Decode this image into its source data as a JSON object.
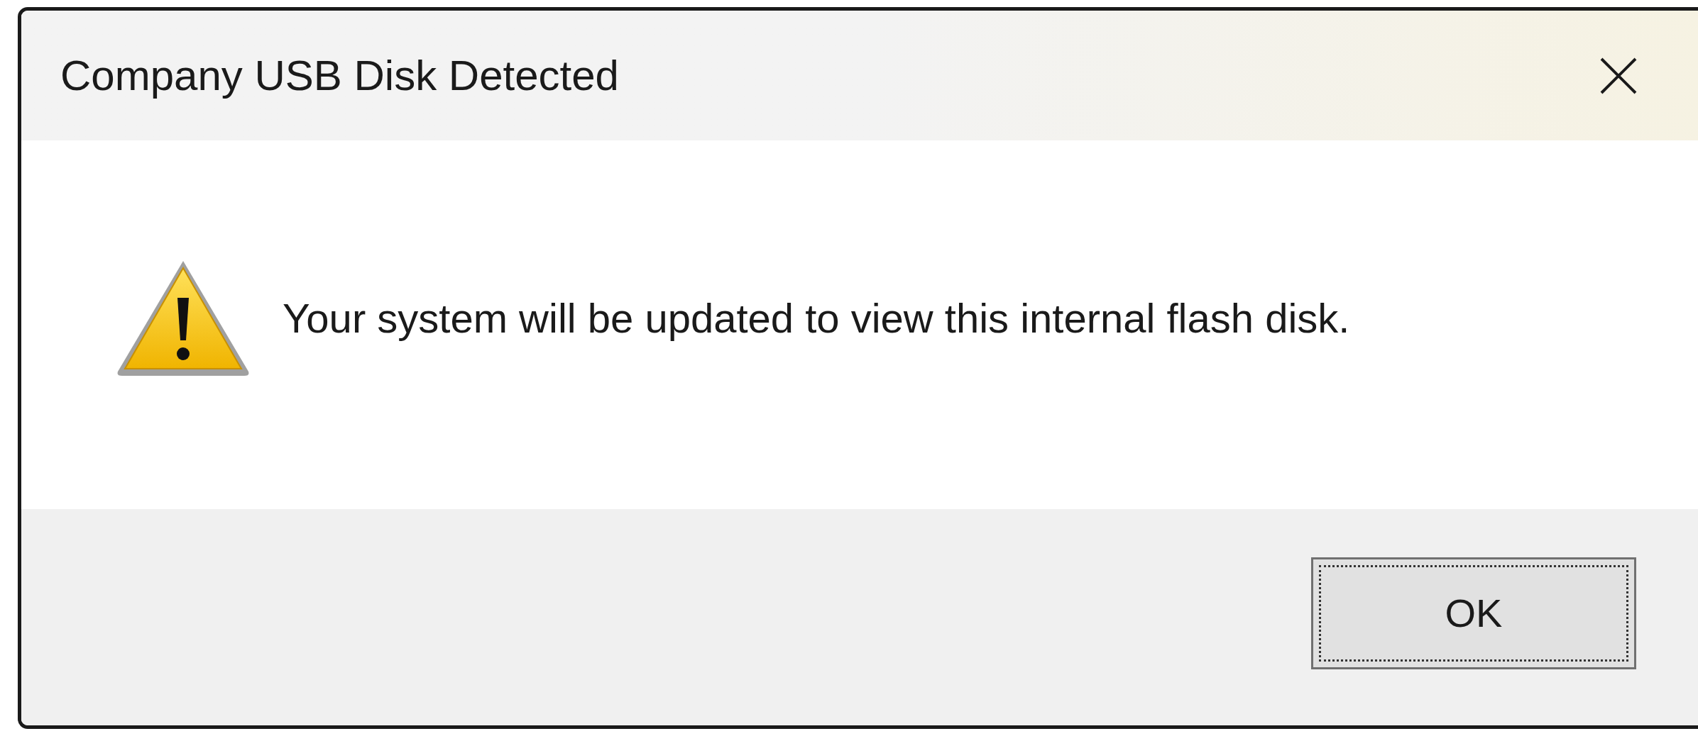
{
  "window": {
    "title": "Company USB Disk Detected"
  },
  "message": "Your system will be updated to view this internal flash disk.",
  "buttons": [
    {
      "label": "OK",
      "focused": true
    }
  ]
}
